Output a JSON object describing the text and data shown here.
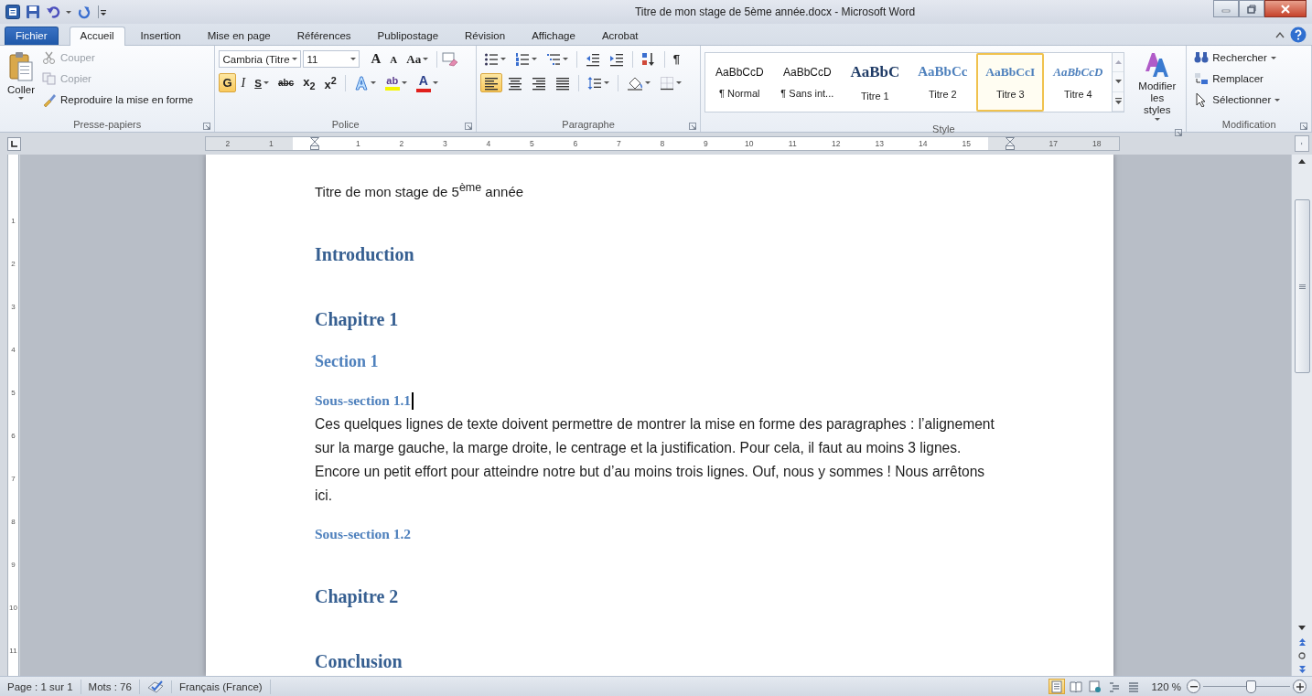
{
  "window": {
    "title": "Titre de mon stage de 5ème année.docx - Microsoft Word"
  },
  "tabs": [
    {
      "label": "Fichier",
      "kind": "file",
      "selected": false
    },
    {
      "label": "Accueil",
      "kind": "tab",
      "selected": true
    },
    {
      "label": "Insertion",
      "kind": "tab",
      "selected": false
    },
    {
      "label": "Mise en page",
      "kind": "tab",
      "selected": false
    },
    {
      "label": "Références",
      "kind": "tab",
      "selected": false
    },
    {
      "label": "Publipostage",
      "kind": "tab",
      "selected": false
    },
    {
      "label": "Révision",
      "kind": "tab",
      "selected": false
    },
    {
      "label": "Affichage",
      "kind": "tab",
      "selected": false
    },
    {
      "label": "Acrobat",
      "kind": "tab",
      "selected": false
    }
  ],
  "clipboard": {
    "paste": "Coller",
    "group": "Presse-papiers",
    "items": [
      {
        "label": "Couper",
        "kind": "cut",
        "disabled": true
      },
      {
        "label": "Copier",
        "kind": "copy",
        "disabled": true
      },
      {
        "label": "Reproduire la mise en forme",
        "kind": "painter",
        "disabled": false
      }
    ]
  },
  "font": {
    "name": "Cambria (Titre",
    "size": "11",
    "group": "Police",
    "row1": [
      {
        "label": "A",
        "kind": "grow"
      },
      {
        "label": "A",
        "kind": "shrink"
      },
      {
        "label": "Aa",
        "kind": "case"
      }
    ],
    "row2": [
      {
        "label": "G",
        "kind": "bold",
        "on": true
      },
      {
        "label": "I",
        "kind": "italic",
        "on": false
      },
      {
        "label": "S",
        "kind": "underline",
        "on": false
      },
      {
        "label": "abc",
        "kind": "strike",
        "on": false
      },
      {
        "label": "x$_{2}$",
        "kind": "script",
        "on": false
      },
      {
        "label": "x$^{2}$",
        "kind": "script",
        "on": false
      }
    ],
    "colors": [
      {
        "label": "ab",
        "kind": "highlight",
        "color": "#f5f500"
      },
      {
        "label": "A",
        "kind": "fontcolor",
        "color": "#e0201c"
      }
    ]
  },
  "paragraph": {
    "group": "Paragraphe",
    "pilcrow": "¶",
    "align": [
      {
        "selected": true
      },
      {
        "selected": false
      },
      {
        "selected": false
      },
      {
        "selected": false
      }
    ]
  },
  "styles": {
    "group": "Style",
    "change": "Modifier les styles",
    "items": [
      {
        "preview": "AaBbCcD",
        "label": "¶ Normal",
        "kind": "normal",
        "selected": false
      },
      {
        "preview": "AaBbCcD",
        "label": "¶ Sans int...",
        "kind": "normal",
        "selected": false
      },
      {
        "preview": "AaBbC",
        "label": "Titre 1",
        "kind": "h1",
        "selected": false
      },
      {
        "preview": "AaBbCc",
        "label": "Titre 2",
        "kind": "h2",
        "selected": false
      },
      {
        "preview": "AaBbCcI",
        "label": "Titre 3",
        "kind": "h3",
        "selected": true
      },
      {
        "preview": "AaBbCcD",
        "label": "Titre 4",
        "kind": "h4",
        "selected": false
      }
    ]
  },
  "editing": {
    "group": "Modification",
    "items": [
      {
        "label": "Rechercher",
        "kind": "find",
        "dropdown": true
      },
      {
        "label": "Remplacer",
        "kind": "replace",
        "dropdown": false
      },
      {
        "label": "Sélectionner",
        "kind": "select",
        "dropdown": true
      }
    ]
  },
  "ruler": {
    "left_labels": [
      "2",
      "1"
    ],
    "labels": [
      "1",
      "2",
      "3",
      "4",
      "5",
      "6",
      "7",
      "8",
      "9",
      "10",
      "11",
      "12",
      "13",
      "14",
      "15"
    ],
    "right_labels": [
      "17",
      "18"
    ]
  },
  "vertical_ruler": {
    "labels": [
      "1",
      "2",
      "3",
      "4",
      "5",
      "6",
      "7",
      "8",
      "9",
      "10",
      "11"
    ]
  },
  "document": {
    "paragraphs": [
      {
        "kind": "title",
        "text": "Titre de mon stage de 5$^{ème}$ année",
        "cursor": false
      },
      {
        "kind": "heading1",
        "text": "Introduction",
        "cursor": false
      },
      {
        "kind": "heading1",
        "text": "Chapitre 1",
        "cursor": false
      },
      {
        "kind": "heading2",
        "text": "Section 1",
        "cursor": false
      },
      {
        "kind": "heading3",
        "text": "Sous-section 1.1",
        "cursor": true
      },
      {
        "kind": "body",
        "text": "Ces quelques lignes de texte doivent permettre de montrer la mise en forme des paragraphes : l’alignement sur la marge gauche, la marge droite, le centrage et la justification. Pour cela, il faut au moins 3 lignes. Encore un petit effort pour atteindre notre but d’au moins trois lignes. Ouf, nous y sommes ! Nous arrêtons ici.",
        "cursor": false
      },
      {
        "kind": "heading3",
        "text": "Sous-section 1.2",
        "cursor": false
      },
      {
        "kind": "heading1",
        "text": "Chapitre 2",
        "cursor": false
      },
      {
        "kind": "heading1",
        "text": "Conclusion",
        "cursor": false
      }
    ]
  },
  "status_bar": {
    "page": "Page : 1 sur 1",
    "words": "Mots : 76",
    "language": "Français (France)",
    "views": [
      {
        "selected": true
      },
      {
        "selected": false
      },
      {
        "selected": false
      },
      {
        "selected": false
      },
      {
        "selected": false
      }
    ],
    "zoom": "120 %",
    "zoom_slider": {
      "level": 0.55
    }
  }
}
